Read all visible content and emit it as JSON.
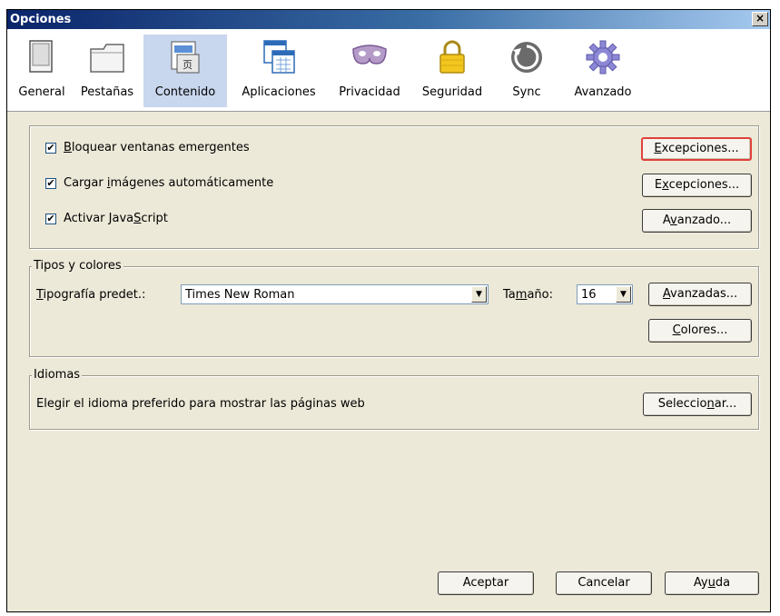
{
  "window": {
    "title": "Opciones",
    "close_glyph": "×"
  },
  "toolbar": [
    {
      "label": "General",
      "icon": "general-icon",
      "selected": false
    },
    {
      "label": "Pestañas",
      "icon": "tabs-icon",
      "selected": false
    },
    {
      "label": "Contenido",
      "icon": "content-icon",
      "selected": true
    },
    {
      "label": "Aplicaciones",
      "icon": "applications-icon",
      "selected": false
    },
    {
      "label": "Privacidad",
      "icon": "privacy-mask-icon",
      "selected": false
    },
    {
      "label": "Seguridad",
      "icon": "padlock-icon",
      "selected": false
    },
    {
      "label": "Sync",
      "icon": "sync-icon",
      "selected": false
    },
    {
      "label": "Avanzado",
      "icon": "gear-icon",
      "selected": false
    }
  ],
  "content": {
    "popups": {
      "checked": true,
      "label_key": "B",
      "label_rest": "loquear ventanas emergentes",
      "button_key": "E",
      "button_rest": "xcepciones..."
    },
    "images": {
      "checked": true,
      "label_pre": "Cargar ",
      "label_key": "i",
      "label_post": "mágenes automáticamente",
      "button_pre": "E",
      "button_key": "x",
      "button_post": "cepciones..."
    },
    "javascript": {
      "checked": true,
      "label_pre": "Activar Java",
      "label_key": "S",
      "label_post": "cript",
      "button_pre": "A",
      "button_key": "v",
      "button_post": "anzado..."
    }
  },
  "fonts": {
    "legend": "Tipos y colores",
    "default_font_key": "T",
    "default_font_rest": "ipografía predet.:",
    "font_value": "Times New Roman",
    "size_pre": "Ta",
    "size_key": "m",
    "size_post": "año:",
    "size_value": "16",
    "advanced_key": "A",
    "advanced_rest": "vanzadas...",
    "colors_key": "C",
    "colors_rest": "olores..."
  },
  "languages": {
    "legend": "Idiomas",
    "description": "Elegir el idioma preferido para mostrar las páginas web",
    "button_pre": "Seleccio",
    "button_key": "n",
    "button_post": "ar..."
  },
  "footer": {
    "ok": "Aceptar",
    "cancel": "Cancelar",
    "help_pre": "Ay",
    "help_key": "u",
    "help_post": "da"
  },
  "colors": {
    "accent": "#c8d6ee",
    "focus_border": "#e0403a",
    "dialog_bg": "#ece9d8"
  }
}
